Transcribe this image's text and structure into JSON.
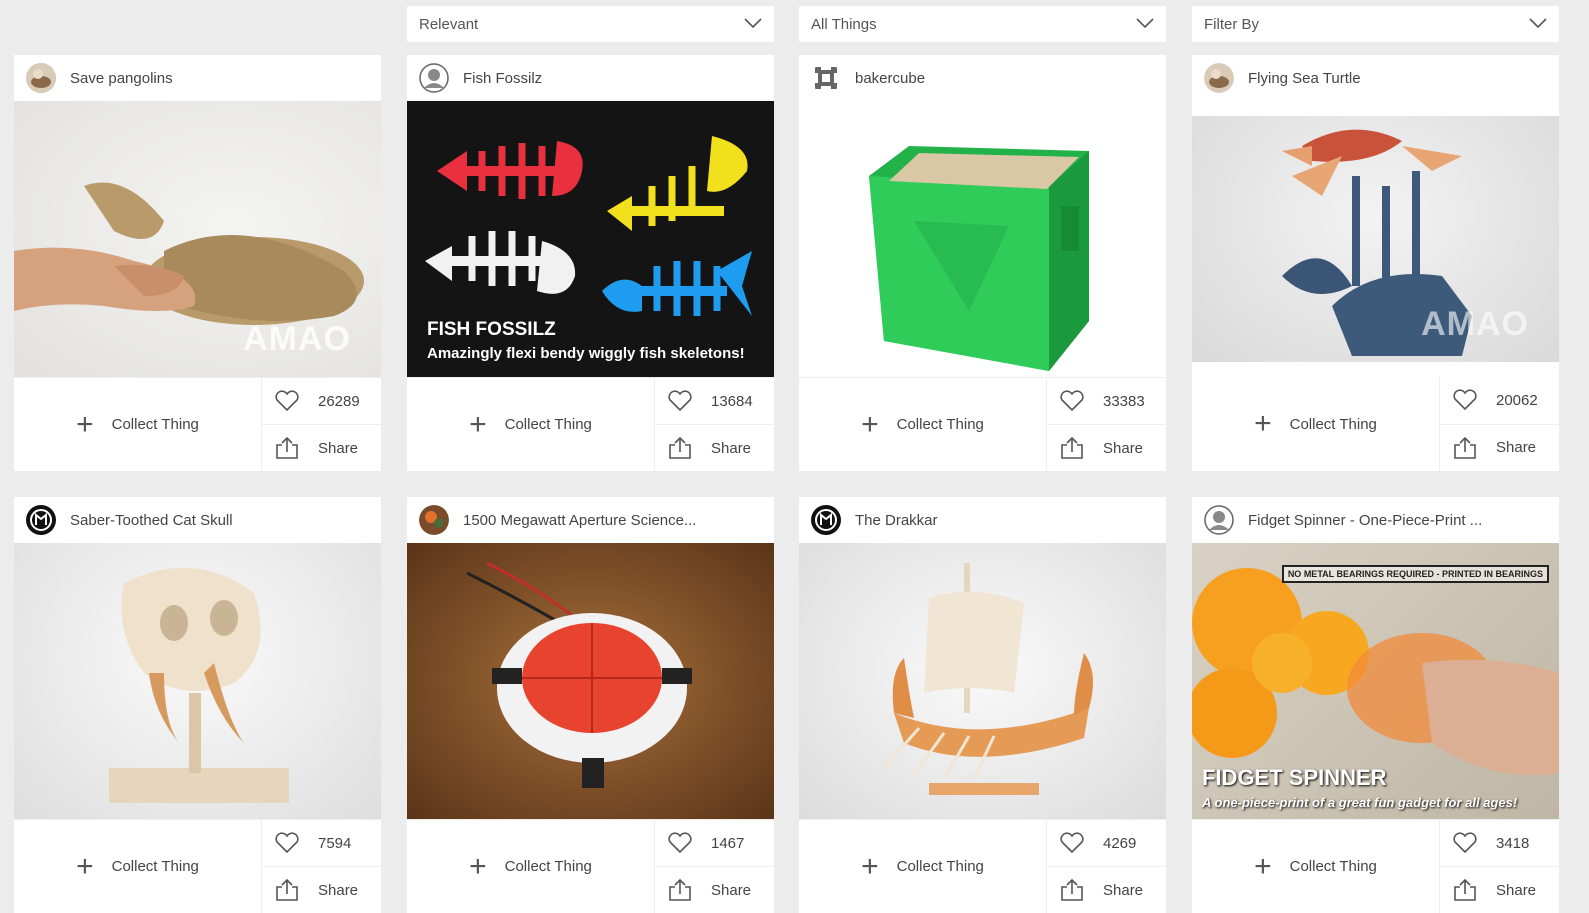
{
  "filters": [
    {
      "label": "Relevant"
    },
    {
      "label": "All Things"
    },
    {
      "label": "Filter By"
    }
  ],
  "actions": {
    "collect_label": "Collect Thing",
    "share_label": "Share"
  },
  "cards": [
    {
      "title": "Save pangolins",
      "likes": "26289",
      "avatar": "photo-avatar",
      "image_text": "AMAO"
    },
    {
      "title": "Fish Fossilz",
      "likes": "13684",
      "avatar": "default-avatar",
      "image_title": "FISH FOSSILZ",
      "image_subtitle": "Amazingly flexi bendy wiggly fish skeletons!"
    },
    {
      "title": "bakercube",
      "likes": "33383",
      "avatar": "cube-logo-avatar"
    },
    {
      "title": "Flying Sea Turtle",
      "likes": "20062",
      "avatar": "photo-avatar",
      "image_text": "AMAO"
    },
    {
      "title": "Saber-Toothed Cat Skull",
      "likes": "7594",
      "avatar": "makerbot-logo-avatar"
    },
    {
      "title": "1500 Megawatt Aperture Science...",
      "likes": "1467",
      "avatar": "photo-avatar"
    },
    {
      "title": "The Drakkar",
      "likes": "4269",
      "avatar": "makerbot-logo-avatar"
    },
    {
      "title": "Fidget Spinner - One-Piece-Print ...",
      "likes": "3418",
      "avatar": "default-avatar",
      "image_banner": "NO METAL BEARINGS REQUIRED - PRINTED IN BEARINGS",
      "image_title": "FIDGET SPINNER",
      "image_subtitle": "A one-piece-print of a great fun gadget for all ages!"
    }
  ]
}
